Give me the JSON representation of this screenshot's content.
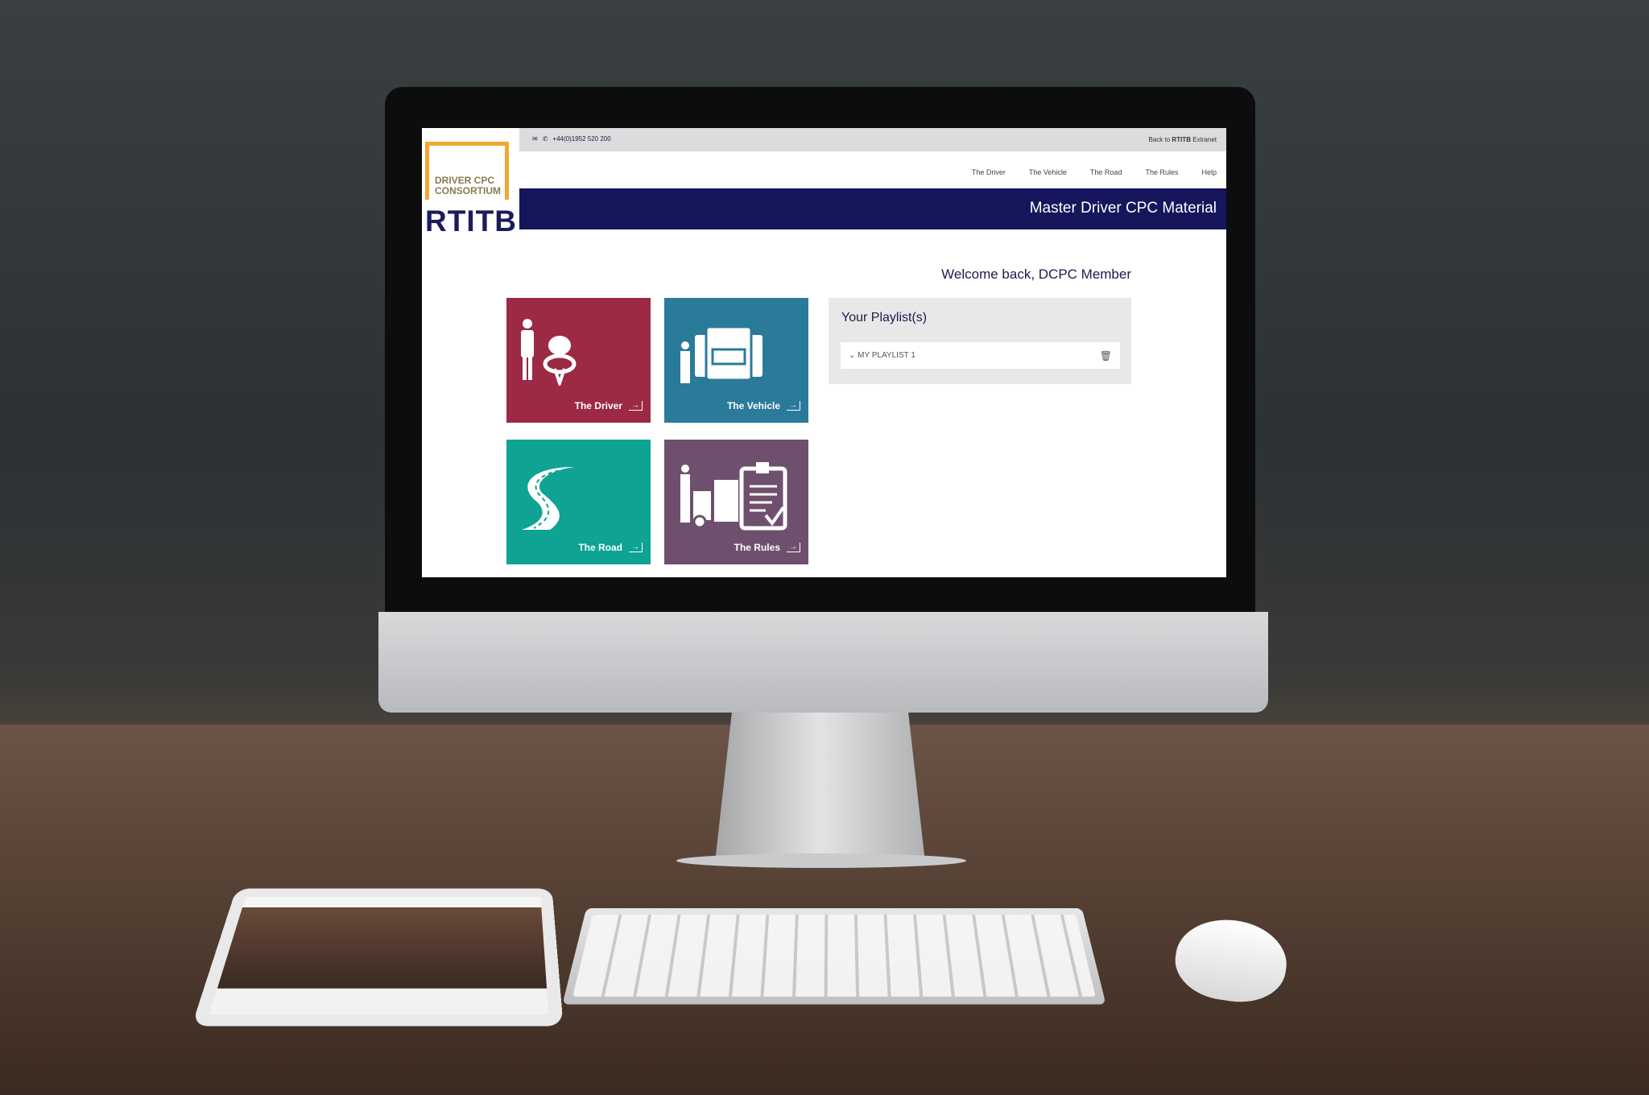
{
  "topbar": {
    "phone": "+44(0)1952 520 200",
    "back_prefix": "Back to ",
    "back_brand": "RTITB",
    "back_suffix": " Extranet"
  },
  "logo": {
    "line1": "DRIVER CPC",
    "line2": "CONSORTIUM",
    "brand": "RTITB"
  },
  "nav": [
    "The Driver",
    "The Vehicle",
    "The Road",
    "The Rules",
    "Help"
  ],
  "banner": {
    "title": "Master Driver CPC Material"
  },
  "welcome": "Welcome back, DCPC Member",
  "tiles": [
    {
      "label": "The Driver",
      "color": "#9c2a45",
      "icon": "driver-steering-icon"
    },
    {
      "label": "The Vehicle",
      "color": "#2a7a9a",
      "icon": "trucks-icon"
    },
    {
      "label": "The Road",
      "color": "#0fa393",
      "icon": "road-icon"
    },
    {
      "label": "The Rules",
      "color": "#6f4f6e",
      "icon": "rules-clipboard-icon"
    }
  ],
  "playlist": {
    "title": "Your Playlist(s)",
    "items": [
      {
        "name": "MY PLAYLIST 1"
      }
    ]
  },
  "colors": {
    "brand_navy": "#16165c",
    "brand_orange": "#f0a830"
  }
}
